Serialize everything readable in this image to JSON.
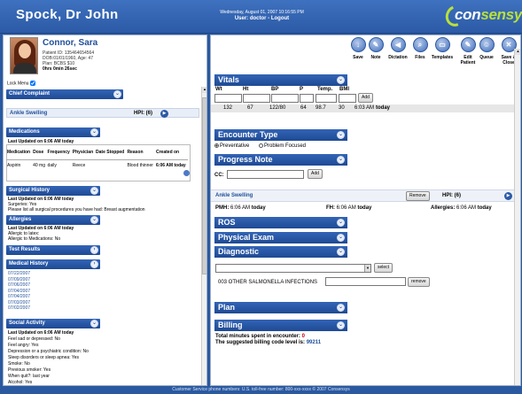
{
  "header": {
    "doctor_name": "Spock, Dr John",
    "date": "Wednesday, August 01, 2007 10:16:55 PM",
    "user_prefix": "User:",
    "user_name": "doctor",
    "separator": "-",
    "logout": "Logout",
    "logo_part1": "con",
    "logo_part2": "sensys"
  },
  "patient": {
    "name": "Connor, Sara",
    "patient_id": "Patient ID: 135464654564",
    "dob": "DOB:01/01/1960, Age: 47",
    "plan": "Plan: BCBS $10",
    "time": "0hrs 0min 26sec"
  },
  "lock_menu": "Lock Menu",
  "left": {
    "chief_complaint": "Chief Complaint",
    "cc_item": "Ankle Swelling",
    "cc_hpi": "HPI: (6)",
    "medications": "Medications",
    "med_updated": "Last Updated on 6:06 AM today",
    "med_headers": [
      "Medication",
      "Dose",
      "Frequency",
      "Physician",
      "Date Stopped",
      "Reason",
      "Created on"
    ],
    "med_row": [
      "Aspirin",
      "40 mg",
      "daily",
      "Reece",
      "",
      "Blood thinner",
      "6:06 AM today"
    ],
    "surgical": "Surgical History",
    "surg_updated": "Last Updated on 6:06 AM today",
    "surg_lines": [
      "Surgeries: Yes",
      "Please list all surgical procedures you have had: Breast augmentation"
    ],
    "allergies": "Allergies",
    "allergy_updated": "Last Updated on 6:06 AM today",
    "allergy_lines": [
      "Allergic to latex:",
      "Allergic to Medications: No"
    ],
    "test_results": "Test Results",
    "medical_history": "Medical History",
    "med_hist_dates": [
      "07/22/2007",
      "07/09/2007",
      "07/06/2007",
      "07/04/2007",
      "07/04/2007",
      "07/03/2007",
      "07/02/2007"
    ],
    "social": "Social Activity",
    "social_updated": "Last Updated on 6:06 AM today",
    "social_lines": [
      "Feel sad or depressed: No",
      "Feel angry: Yes",
      "Depression or a psychiatric condition: No",
      "Sleep disorders or sleep apnea: Yes",
      "Smoke: No",
      "Previous smoker: Yes",
      "When quit?: last year",
      "Alcohol: Yes"
    ]
  },
  "toolbar": {
    "save": "Save",
    "note": "Note",
    "dictation": "Dictation",
    "files": "Files",
    "templates": "Templates",
    "edit_patient": "Edit Patient",
    "queue": "Queue",
    "save_close": "Save & Close"
  },
  "right": {
    "vitals": "Vitals",
    "vital_labels": [
      "Wt",
      "Ht",
      "BP",
      "P",
      "Temp.",
      "BMI"
    ],
    "add": "Add",
    "vital_values": [
      "132",
      "67",
      "122/80",
      "64",
      "98.7",
      "30",
      "6:03 AM"
    ],
    "vital_when": "today",
    "encounter_type": "Encounter Type",
    "enc_options": [
      "Preventative",
      "Problem Focused"
    ],
    "progress_note": "Progress Note",
    "cc_label": "CC:",
    "ankle": "Ankle Swelling",
    "remove": "Remove",
    "hpi": "HPI: (6)",
    "pmh_label": "PMH:",
    "pmh_time": "6:06 AM",
    "pmh_when": "today",
    "fh_label": "FH:",
    "fh_time": "6:06 AM",
    "fh_when": "today",
    "allergies_label": "Allergies:",
    "allergies_time": "6:06 AM",
    "allergies_when": "today",
    "ros": "ROS",
    "physical_exam": "Physical Exam",
    "diagnostic": "Diagnostic",
    "select_btn": "select",
    "salmonella": "003 OTHER SALMONELLA INFECTIONS",
    "remove2": "remove",
    "plan": "Plan",
    "billing": "Billing",
    "total_label": "Total minutes spent in encounter:",
    "total_val": "0",
    "billing_label": "The suggested billing code level is:",
    "billing_val": "99211"
  },
  "footer": "Customer Service phone numbers: U.S. toll-free number: 800-xxx-xxxx   © 2007 Consensys"
}
